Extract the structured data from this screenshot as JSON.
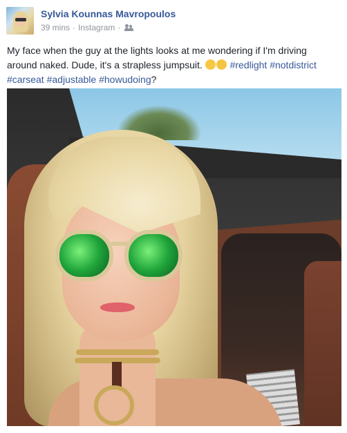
{
  "post": {
    "author": "Sylvia Kounnas Mavropoulos",
    "time": "39 mins",
    "source": "Instagram",
    "audience_icon": "friends-icon",
    "text_main": "My face when the guy at the lights looks at me wondering if I'm driving around naked. Dude, it's a strapless jumpsuit. ",
    "emojis": [
      "grinning-squint-face-emoji",
      "face-screaming-emoji"
    ],
    "hashtags": [
      "#redlight",
      "#notdistrict",
      "#carseat",
      "#adjustable",
      "#howudoing"
    ],
    "text_end": "?",
    "link_color": "#365899",
    "author_color": "#365899",
    "meta_color": "#90949c"
  }
}
